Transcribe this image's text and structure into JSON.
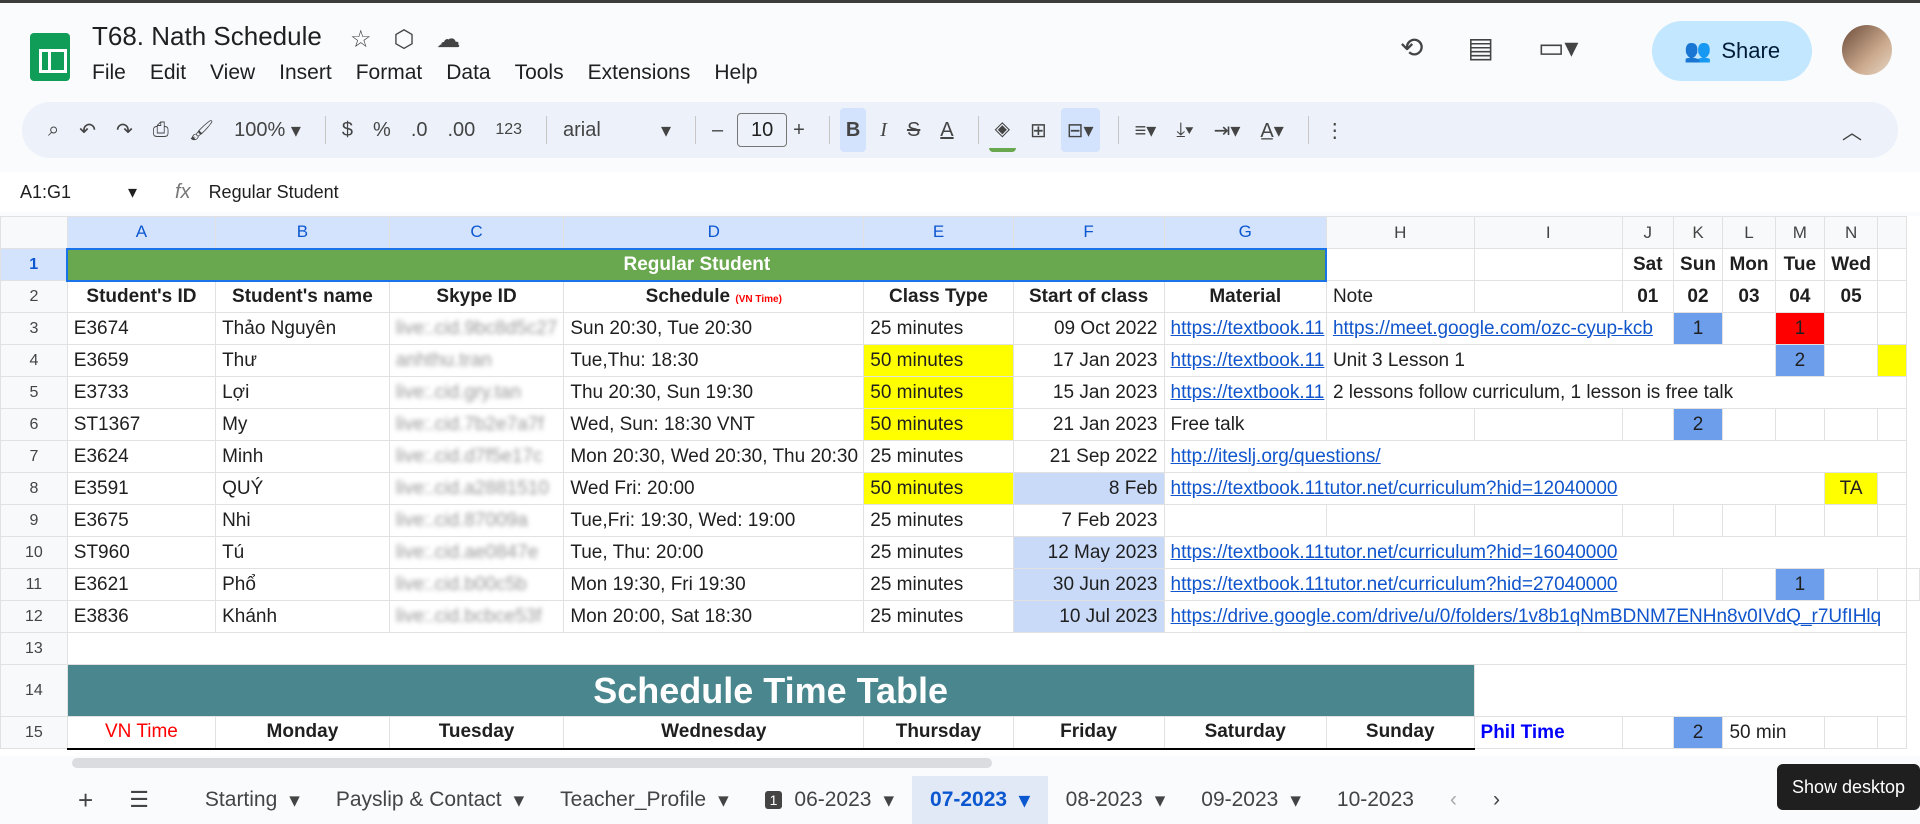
{
  "doc": {
    "title": "T68. Nath Schedule"
  },
  "menu": [
    "File",
    "Edit",
    "View",
    "Insert",
    "Format",
    "Data",
    "Tools",
    "Extensions",
    "Help"
  ],
  "share_label": "Share",
  "toolbar": {
    "zoom": "100%",
    "currency": "$",
    "percent": "%",
    "dec_less": ".0",
    "dec_more": ".00",
    "number_format": "123",
    "font": "arial",
    "font_size": "10",
    "minus": "–",
    "plus": "+"
  },
  "formula": {
    "namebox": "A1:G1",
    "fx": "fx",
    "value": "Regular Student"
  },
  "columns": [
    "A",
    "B",
    "C",
    "D",
    "E",
    "F",
    "G",
    "H",
    "I",
    "J",
    "K",
    "L",
    "M",
    "N"
  ],
  "rows": {
    "title": "Regular Student",
    "days": [
      "Sat",
      "Sun",
      "Mon",
      "Tue",
      "Wed"
    ],
    "dates": [
      "01",
      "02",
      "03",
      "04",
      "05"
    ],
    "headers": {
      "id": "Student's ID",
      "name": "Student's name",
      "skype": "Skype ID",
      "schedule": "Schedule",
      "vn_time": "(VN Time)",
      "class_type": "Class Type",
      "start": "Start of class",
      "material": "Material",
      "note": "Note"
    },
    "students": [
      {
        "id": "E3674",
        "name": "Thảo Nguyên",
        "skype": "live:.cid.9bc8d5c27",
        "schedule": "Sun 20:30, Tue 20:30",
        "type": "25 minutes",
        "start": "09 Oct 2022",
        "material": "https://textbook.11",
        "note": "https://meet.google.com/ozc-cyup-kcb",
        "k": "1",
        "m": "1"
      },
      {
        "id": "E3659",
        "name": "Thư",
        "skype": "anhthu.tran",
        "schedule": "Tue,Thu: 18:30",
        "type": "50 minutes",
        "start": "17 Jan 2023",
        "material": "https://textbook.11",
        "note": "Unit 3 Lesson 1",
        "m": "2"
      },
      {
        "id": "E3733",
        "name": "Lợi",
        "skype": "live:.cid.gry.tan",
        "schedule": "Thu 20:30, Sun 19:30",
        "type": "50 minutes",
        "start": "15 Jan 2023",
        "material": "https://textbook.11",
        "note": "2 lessons follow curriculum, 1 lesson is free talk"
      },
      {
        "id": "ST1367",
        "name": "My",
        "skype": "live:.cid.7b2e7a7f",
        "schedule": "Wed, Sun: 18:30 VNT",
        "type": "50 minutes",
        "start": "21 Jan 2023",
        "material": "Free talk",
        "k": "2"
      },
      {
        "id": "E3624",
        "name": "Minh",
        "skype": "live:.cid.d7f5e17c",
        "schedule": "Mon 20:30, Wed 20:30, Thu 20:30",
        "type": "25 minutes",
        "start": "21 Sep 2022",
        "material": "http://iteslj.org/questions/"
      },
      {
        "id": "E3591",
        "name": "QUÝ",
        "skype": "live:.cid.a2881510",
        "schedule": "Wed Fri: 20:00",
        "type": "50 minutes",
        "start": "8 Feb",
        "material": "https://textbook.11tutor.net/curriculum?hid=12040000",
        "n": "TA"
      },
      {
        "id": "E3675",
        "name": "Nhi",
        "skype": "live:.cid.87009a",
        "schedule": "Tue,Fri: 19:30, Wed: 19:00",
        "type": "25 minutes",
        "start": "7 Feb 2023"
      },
      {
        "id": "ST960",
        "name": "Tú",
        "skype": "live:.cid.ae0847e",
        "schedule": "Tue, Thu: 20:00",
        "type": "25 minutes",
        "start": "12 May 2023",
        "material": "https://textbook.11tutor.net/curriculum?hid=16040000"
      },
      {
        "id": "E3621",
        "name": "Phổ",
        "skype": "live:.cid.b00c5b",
        "schedule": "Mon 19:30, Fri 19:30",
        "type": "25 minutes",
        "start": "30 Jun 2023",
        "material": "https://textbook.11tutor.net/curriculum?hid=27040000",
        "l": "1"
      },
      {
        "id": "E3836",
        "name": "Khánh",
        "skype": "live:.cid.bcbce53f",
        "schedule": "Mon 20:00, Sat 18:30",
        "type": "25 minutes",
        "start": "10 Jul 2023",
        "material": "https://drive.google.com/drive/u/0/folders/1v8b1qNmBDNM7ENHn8v0IVdQ_r7UfIHlq"
      }
    ],
    "timetable_title": "Schedule Time Table",
    "tt_headers": {
      "vn": "VN Time",
      "mon": "Monday",
      "tue": "Tuesday",
      "wed": "Wednesday",
      "thu": "Thursday",
      "fri": "Friday",
      "sat": "Saturday",
      "sun": "Sunday",
      "phil": "Phil Time",
      "j15": "2",
      "k15": "50 min"
    }
  },
  "tabs": [
    {
      "label": "Starting"
    },
    {
      "label": "Payslip & Contact"
    },
    {
      "label": "Teacher_Profile"
    },
    {
      "label": "06-2023",
      "badge": "1"
    },
    {
      "label": "07-2023",
      "active": true
    },
    {
      "label": "08-2023"
    },
    {
      "label": "09-2023"
    },
    {
      "label": "10-2023"
    }
  ],
  "tooltip": "Show desktop"
}
